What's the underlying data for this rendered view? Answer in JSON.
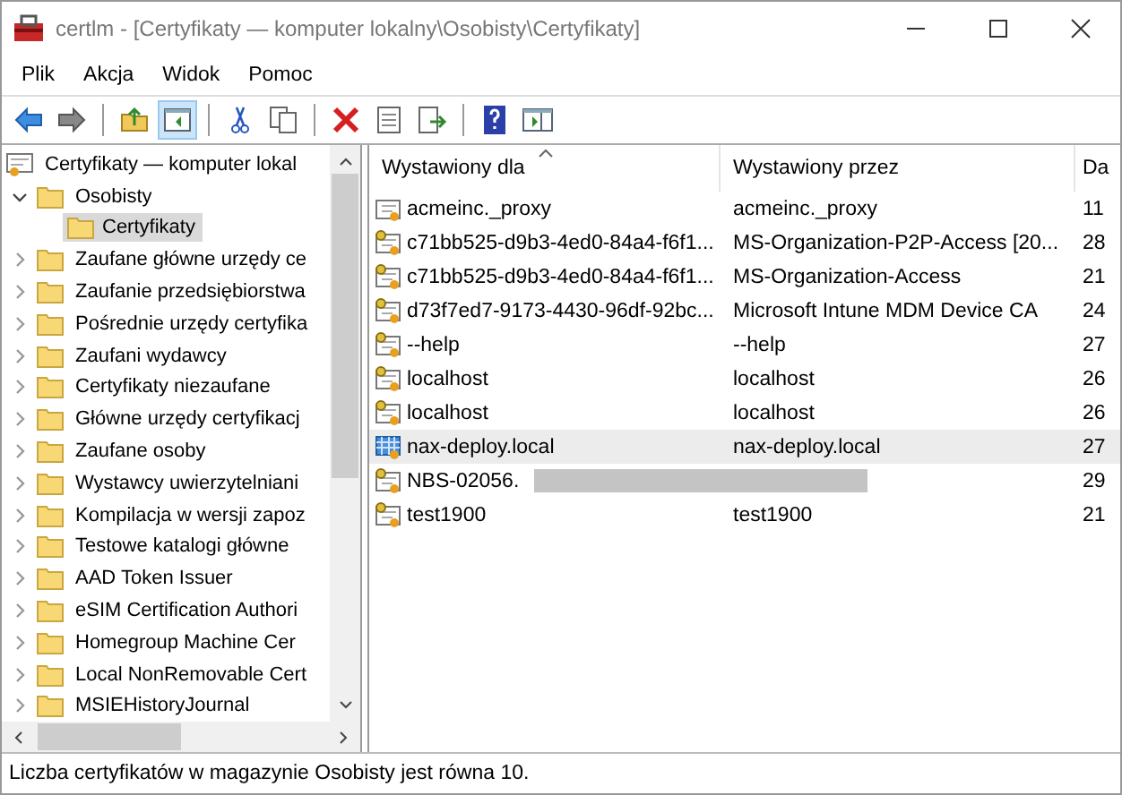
{
  "window": {
    "title": "certlm - [Certyfikaty — komputer lokalny\\Osobisty\\Certyfikaty]"
  },
  "menu": [
    "Plik",
    "Akcja",
    "Widok",
    "Pomoc"
  ],
  "toolbar": [
    {
      "kind": "back",
      "pressed": false
    },
    {
      "kind": "forward",
      "pressed": false
    },
    {
      "kind": "sep"
    },
    {
      "kind": "up",
      "pressed": false
    },
    {
      "kind": "tree",
      "pressed": true
    },
    {
      "kind": "sep"
    },
    {
      "kind": "cut",
      "pressed": false
    },
    {
      "kind": "copy",
      "pressed": false
    },
    {
      "kind": "sep"
    },
    {
      "kind": "delete",
      "pressed": false
    },
    {
      "kind": "properties",
      "pressed": false
    },
    {
      "kind": "export",
      "pressed": false
    },
    {
      "kind": "sep"
    },
    {
      "kind": "help",
      "pressed": false
    },
    {
      "kind": "pane",
      "pressed": false
    }
  ],
  "tree": {
    "label": "Certyfikaty — komputer lokal",
    "children": [
      {
        "label": "Osobisty",
        "expanded": true,
        "selected": false,
        "children": [
          {
            "label": "Certyfikaty",
            "selected": true
          }
        ]
      },
      {
        "label": "Zaufane główne urzędy ce",
        "expanded": false,
        "selected": false
      },
      {
        "label": "Zaufanie przedsiębiorstwa",
        "expanded": false,
        "selected": false
      },
      {
        "label": "Pośrednie urzędy certyfika",
        "expanded": false,
        "selected": false
      },
      {
        "label": "Zaufani wydawcy",
        "expanded": false,
        "selected": false
      },
      {
        "label": "Certyfikaty niezaufane",
        "expanded": false,
        "selected": false
      },
      {
        "label": "Główne urzędy certyfikacj",
        "expanded": false,
        "selected": false
      },
      {
        "label": "Zaufane osoby",
        "expanded": false,
        "selected": false
      },
      {
        "label": "Wystawcy uwierzytelniani",
        "expanded": false,
        "selected": false
      },
      {
        "label": "Kompilacja w wersji zapoz",
        "expanded": false,
        "selected": false
      },
      {
        "label": "Testowe katalogi główne",
        "expanded": false,
        "selected": false
      },
      {
        "label": "AAD Token Issuer",
        "expanded": false,
        "selected": false
      },
      {
        "label": "eSIM Certification Authori",
        "expanded": false,
        "selected": false
      },
      {
        "label": "Homegroup Machine Cer",
        "expanded": false,
        "selected": false
      },
      {
        "label": "Local NonRemovable Cert",
        "expanded": false,
        "selected": false
      },
      {
        "label": "MSIEHistoryJournal",
        "expanded": false,
        "selected": false
      }
    ]
  },
  "table": {
    "columns": [
      {
        "label": "Wystawiony dla",
        "sorted": true
      },
      {
        "label": "Wystawiony przez",
        "sorted": false
      },
      {
        "label": "Da",
        "sorted": false
      }
    ],
    "rows": [
      {
        "kind": "plain",
        "cells": [
          "acmeinc._proxy",
          "acmeinc._proxy",
          "11"
        ],
        "selected": false,
        "redacted": false
      },
      {
        "kind": "key",
        "cells": [
          "c71bb525-d9b3-4ed0-84a4-f6f1...",
          "MS-Organization-P2P-Access [20...",
          "28"
        ],
        "selected": false,
        "redacted": false
      },
      {
        "kind": "key",
        "cells": [
          "c71bb525-d9b3-4ed0-84a4-f6f1...",
          "MS-Organization-Access",
          "21"
        ],
        "selected": false,
        "redacted": false
      },
      {
        "kind": "key",
        "cells": [
          "d73f7ed7-9173-4430-96df-92bc...",
          "Microsoft Intune MDM Device CA",
          "24"
        ],
        "selected": false,
        "redacted": false
      },
      {
        "kind": "key",
        "cells": [
          "--help",
          "--help",
          "27"
        ],
        "selected": false,
        "redacted": false
      },
      {
        "kind": "key",
        "cells": [
          "localhost",
          "localhost",
          "26"
        ],
        "selected": false,
        "redacted": false
      },
      {
        "kind": "key",
        "cells": [
          "localhost",
          "localhost",
          "26"
        ],
        "selected": false,
        "redacted": false
      },
      {
        "kind": "checked",
        "cells": [
          "nax-deploy.local",
          "nax-deploy.local",
          "27"
        ],
        "selected": true,
        "redacted": false
      },
      {
        "kind": "key",
        "cells": [
          "NBS-02056.",
          "",
          "29"
        ],
        "selected": false,
        "redacted": true
      },
      {
        "kind": "key",
        "cells": [
          "test1900",
          "test1900",
          "21"
        ],
        "selected": false,
        "redacted": false
      }
    ]
  },
  "status_bar": "Liczba certyfikatów w magazynie Osobisty jest równa 10."
}
